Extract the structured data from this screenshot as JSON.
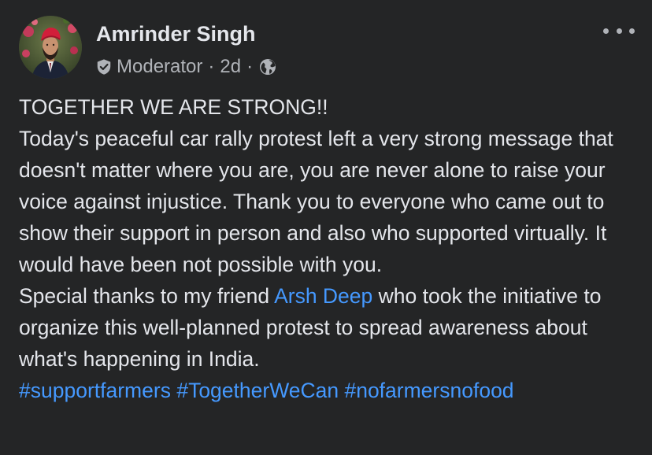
{
  "post": {
    "author": {
      "name": "Amrinder Singh",
      "role": "Moderator",
      "time": "2d",
      "separator": "·",
      "visibility_icon": "globe-icon",
      "badge_icon": "shield-check-icon"
    },
    "more_icon": "more-horizontal-icon",
    "body": {
      "line1": "TOGETHER WE ARE STRONG!!",
      "para2": "Today's peaceful car rally protest left a very strong message that doesn't matter where you are, you are never alone to raise your voice against injustice. Thank you to everyone who came out to show their support in person and also who supported virtually. It would have been not possible with you.",
      "thanks_prefix": "Special thanks to my friend ",
      "mention": "Arsh Deep",
      "thanks_suffix": " who took the initiative to organize this well-planned protest to spread awareness about what's happening in India.",
      "hashtags": [
        "#supportfarmers",
        "#TogetherWeCan",
        "#nofarmersnofood"
      ]
    }
  },
  "colors": {
    "background": "#242526",
    "text_primary": "#e4e6eb",
    "text_secondary": "#b0b3b8",
    "link": "#4599ff"
  }
}
